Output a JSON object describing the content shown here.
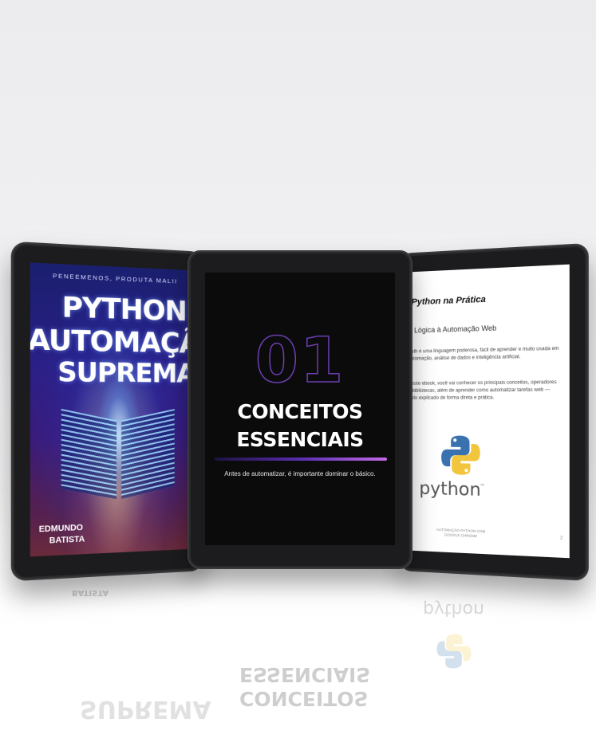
{
  "left_tablet": {
    "top_text": "PENEEMENOS, PRODUTA MALII",
    "title_lines": [
      "PYTHON",
      "AUTOMAÇÃO",
      "SUPREMA"
    ],
    "author_lines": [
      "EDMUNDO",
      "BATISTA"
    ]
  },
  "center_tablet": {
    "chapter_number": "01",
    "title_lines": [
      "CONCEITOS",
      "ESSENCIAIS"
    ],
    "description": "Antes de automatizar, é importante dominar o básico."
  },
  "right_tablet": {
    "heading": "Python na Prática",
    "subheading": "a Lógica à Automação Web",
    "paragraph_1": "Pyth é uma linguagem poderosa, fácil de aprender e muito usada em automação, análise de dados e inteligência artificial.",
    "paragraph_2": "Neste ebook, você vai conhecer os principais conceitos, operadores e bibliotecas, além de aprender como automatizar tarefas web — tudo explicado de forma direta e prática.",
    "logo_word": "python",
    "logo_tm": "™",
    "footer": "AUTOMAÇÃO PYTHON COM GOOGLE CHROME",
    "page_number": "2"
  },
  "colors": {
    "python_blue": "#3a72b0",
    "python_yellow": "#f2c63c",
    "chapter_purple": "#6b3fb0",
    "bar_end": "#c36ae6"
  }
}
